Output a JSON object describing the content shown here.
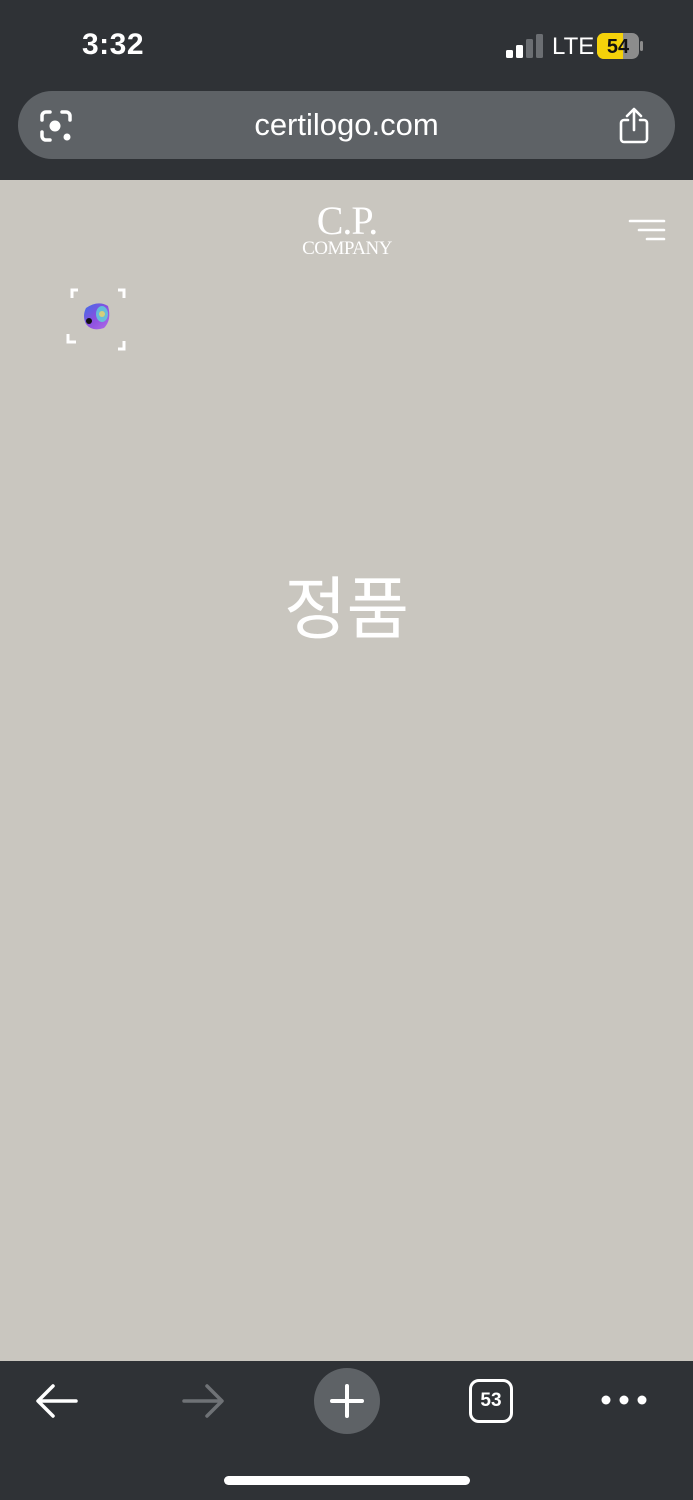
{
  "status_bar": {
    "time": "3:32",
    "network": "LTE",
    "battery_level": "54",
    "battery_color": "#f5d20a",
    "signal_bars_filled": 2,
    "signal_bars_total": 4
  },
  "browser": {
    "url": "certilogo.com",
    "lens_icon": "google-lens-icon",
    "share_icon": "share-icon",
    "tab_count": "53"
  },
  "page": {
    "background_color": "#c9c6bf",
    "logo": {
      "line1": "C.P.",
      "line2": "COMPANY"
    },
    "menu_icon": "hamburger-menu-icon",
    "scan_icon": "scan-widget-icon",
    "result_text": "정품"
  },
  "toolbar": {
    "back_icon": "back-arrow-icon",
    "forward_icon": "forward-arrow-icon",
    "new_tab_icon": "plus-icon",
    "more_icon": "more-dots-icon"
  }
}
